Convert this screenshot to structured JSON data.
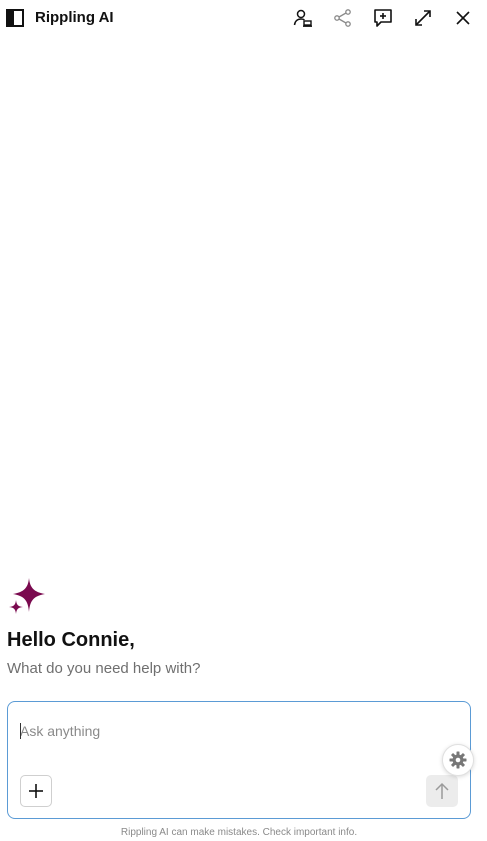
{
  "header": {
    "title": "Rippling AI",
    "icons": {
      "sidebar": "sidebar-toggle-icon",
      "profile": "user-laptop-icon",
      "share": "share-icon",
      "new_chat": "new-chat-icon",
      "expand": "expand-icon",
      "close": "close-icon"
    }
  },
  "main": {
    "greeting": "Hello Connie,",
    "subtitle": "What do you need help with?",
    "brand_color": "#7a0a4f"
  },
  "composer": {
    "placeholder": "Ask anything",
    "value": "",
    "accent_color": "#5b9bd5"
  },
  "footer": {
    "disclaimer": "Rippling AI can make mistakes. Check important info."
  }
}
